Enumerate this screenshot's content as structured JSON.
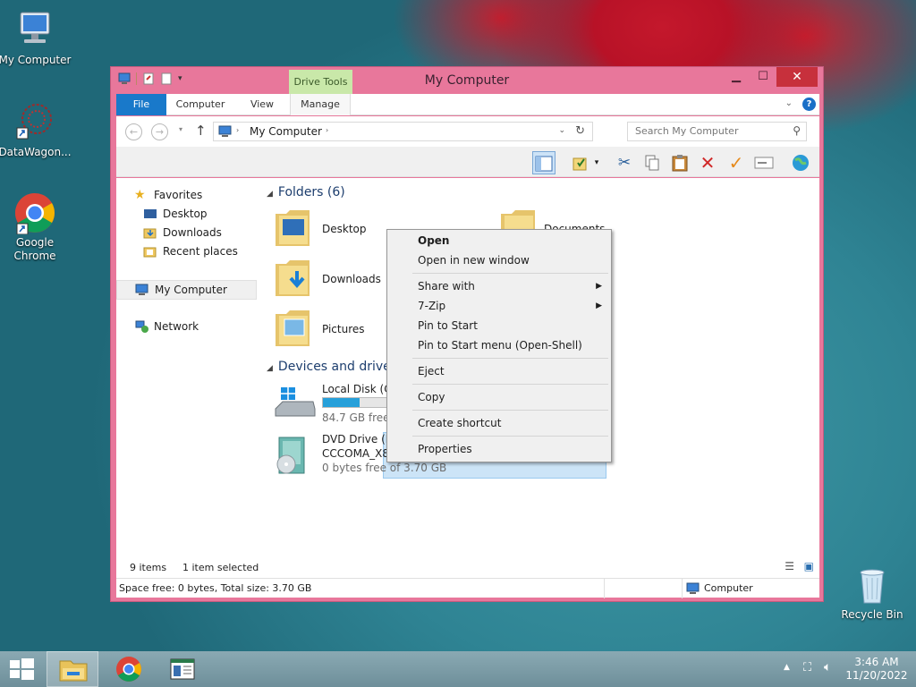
{
  "desktop": {
    "icons": [
      {
        "label": "My Computer"
      },
      {
        "label": "DataWagon..."
      },
      {
        "label": "Google Chrome"
      },
      {
        "label": "Recycle Bin"
      }
    ]
  },
  "window": {
    "title": "My Computer",
    "context_tab": "Drive Tools",
    "tabs": [
      "File",
      "Computer",
      "View",
      "Manage"
    ],
    "address": "My Computer",
    "search_placeholder": "Search My Computer"
  },
  "nav": {
    "favorites": "Favorites",
    "desktop": "Desktop",
    "downloads": "Downloads",
    "recent": "Recent places",
    "mycomputer": "My Computer",
    "network": "Network"
  },
  "content": {
    "folders_header": "Folders (6)",
    "folders": [
      "Desktop",
      "Documents",
      "Downloads",
      "Pictures"
    ],
    "devices_header": "Devices and drives",
    "local_disk": {
      "name": "Local Disk (C:",
      "free": "84.7 GB free o",
      "used_fraction": 0.55
    },
    "dvd": {
      "name": "DVD Drive (E:)",
      "label": "CCCOMA_X8",
      "free": "0 bytes free of 3.70 GB"
    }
  },
  "context_menu": {
    "items": [
      "Open",
      "Open in new window",
      "Share with",
      "7-Zip",
      "Pin to Start",
      "Pin to Start menu (Open-Shell)",
      "Eject",
      "Copy",
      "Create shortcut",
      "Properties"
    ]
  },
  "status": {
    "items": "9 items",
    "selected": "1 item selected",
    "space": "Space free: 0 bytes, Total size: 3.70 GB",
    "location": "Computer"
  },
  "taskbar": {
    "time": "3:46 AM",
    "date": "11/20/2022"
  },
  "colors": {
    "window_frame": "#e8779b",
    "file_tab": "#1979ca",
    "drive_tools": "#c9e8a9",
    "close": "#c7303c",
    "selection": "#cce4f7"
  }
}
